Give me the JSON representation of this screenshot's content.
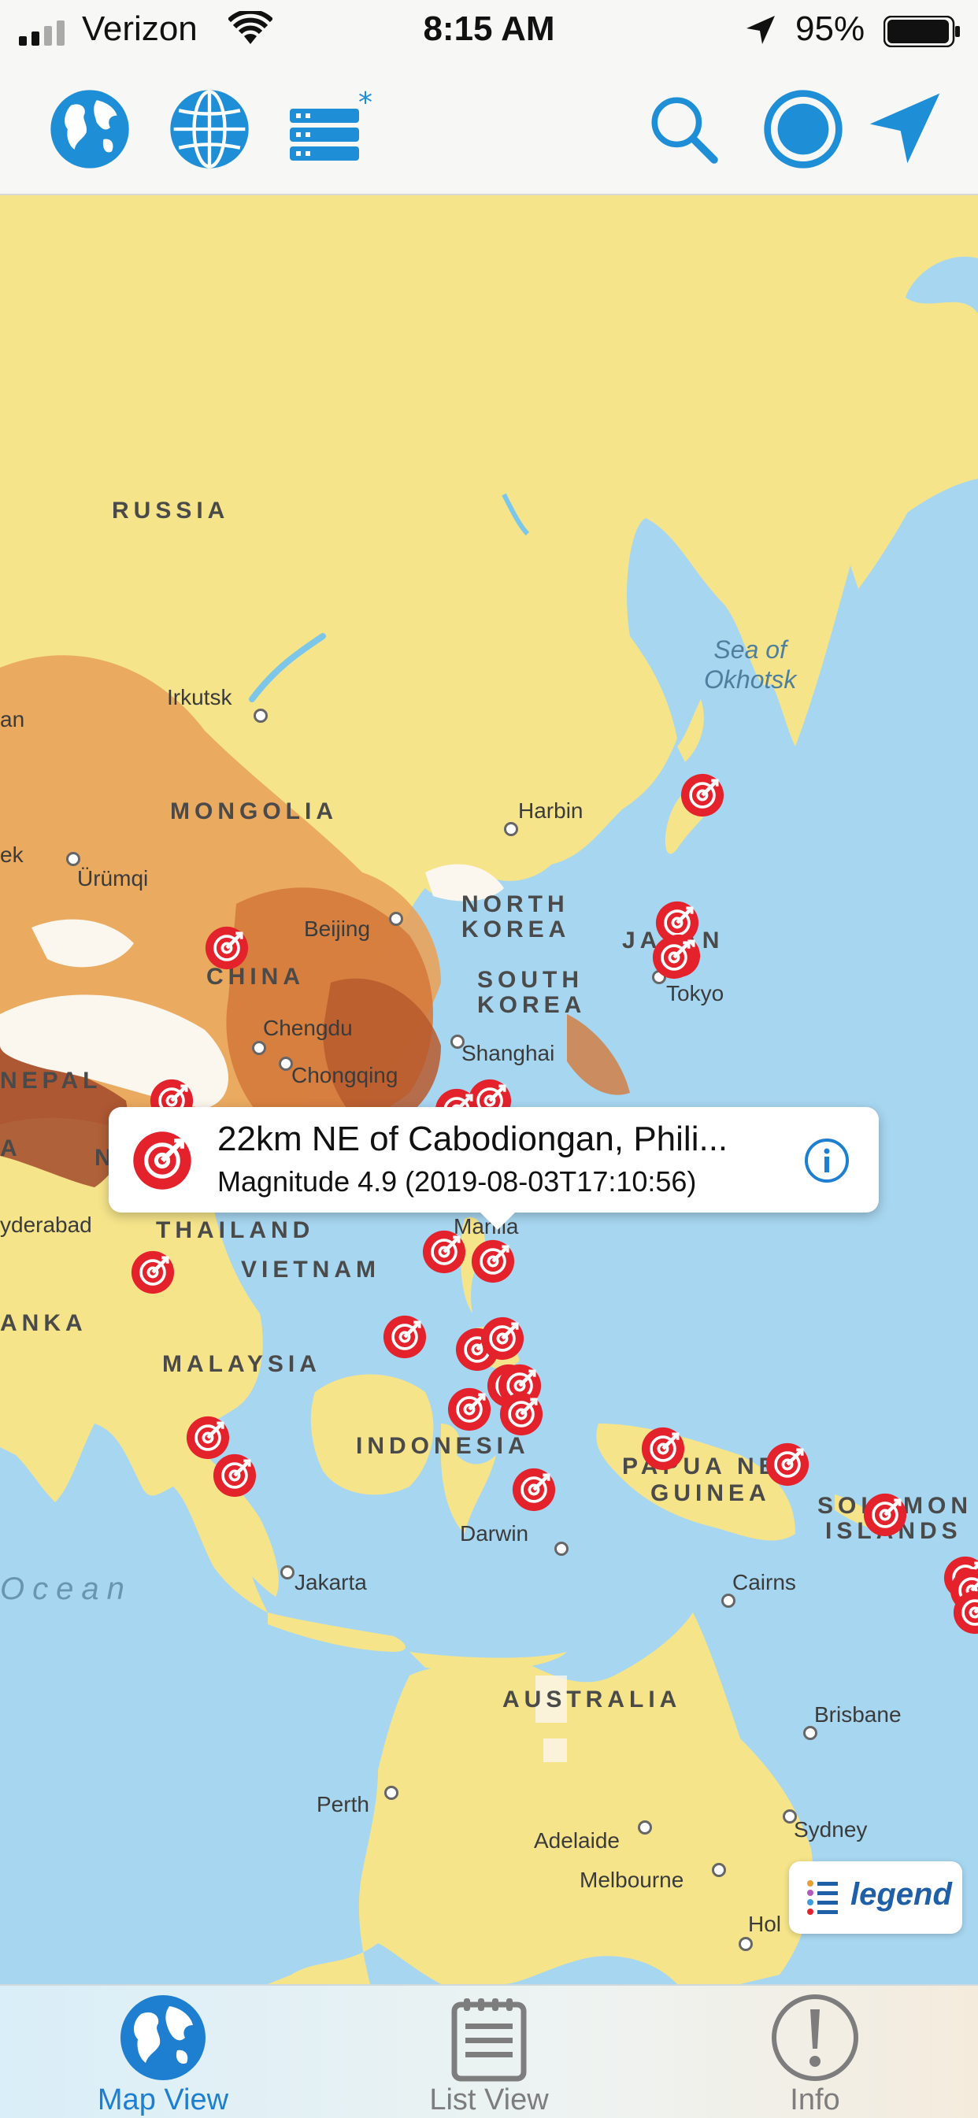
{
  "status_bar": {
    "carrier": "Verizon",
    "time": "8:15 AM",
    "battery": "95%"
  },
  "toolbar": {
    "icons": [
      "globe-icon",
      "grid-globe-icon",
      "server-stack-icon",
      "search-icon",
      "record-icon",
      "location-arrow-icon"
    ],
    "accent_color": "#1e8fd6"
  },
  "map": {
    "labels": {
      "russia": "RUSSIA",
      "mongolia": "MONGOLIA",
      "china": "CHINA",
      "north_korea_1": "NORTH",
      "north_korea_2": "KOREA",
      "south_korea_1": "SOUTH",
      "south_korea_2": "KOREA",
      "japan": "JAPAN",
      "nepal": "NEPAL",
      "thailand": "THAILAND",
      "vietnam": "VIETNAM",
      "sri_lanka": "ANKA",
      "malaysia": "MALAYSIA",
      "indonesia": "INDONESIA",
      "papua_1": "PAPUA NEW",
      "papua_2": "GUINEA",
      "solomon_1": "SOLOMON",
      "solomon_2": "ISLANDS",
      "australia": "AUSTRALIA",
      "sea_okhotsk_1": "Sea of",
      "sea_okhotsk_2": "Okhotsk",
      "ocean": "Ocean",
      "irkutsk": "Irkutsk",
      "harbin": "Harbin",
      "urumqi": "Ürümqi",
      "beijing": "Beijing",
      "tokyo": "Tokyo",
      "chengdu": "Chengdu",
      "chongqing": "Chongqing",
      "shanghai": "Shanghai",
      "manila": "Manila",
      "hyderabad": "yderabad",
      "jakarta": "Jakarta",
      "darwin": "Darwin",
      "cairns": "Cairns",
      "brisbane": "Brisbane",
      "perth": "Perth",
      "adelaide": "Adelaide",
      "sydney": "Sydney",
      "melbourne": "Melbourne",
      "hobart": "Hol",
      "edge_an": "an",
      "edge_ek": "ek",
      "edge_a": "A",
      "edge_n": "N"
    },
    "quake_marker_color": "#e3222c",
    "quake_count": 30
  },
  "callout": {
    "title": "22km NE of Cabodiongan, Phili...",
    "subtitle": "Magnitude 4.9 (2019-08-03T17:10:56)"
  },
  "legend": {
    "label": "legend"
  },
  "tabs": [
    {
      "label": "Map View",
      "icon": "globe-icon",
      "active": true,
      "color": "#1e7fd0"
    },
    {
      "label": "List View",
      "icon": "notepad-icon",
      "active": false,
      "color": "#7d7d7d"
    },
    {
      "label": "Info",
      "icon": "exclamation-icon",
      "active": false,
      "color": "#7d7d7d"
    }
  ]
}
